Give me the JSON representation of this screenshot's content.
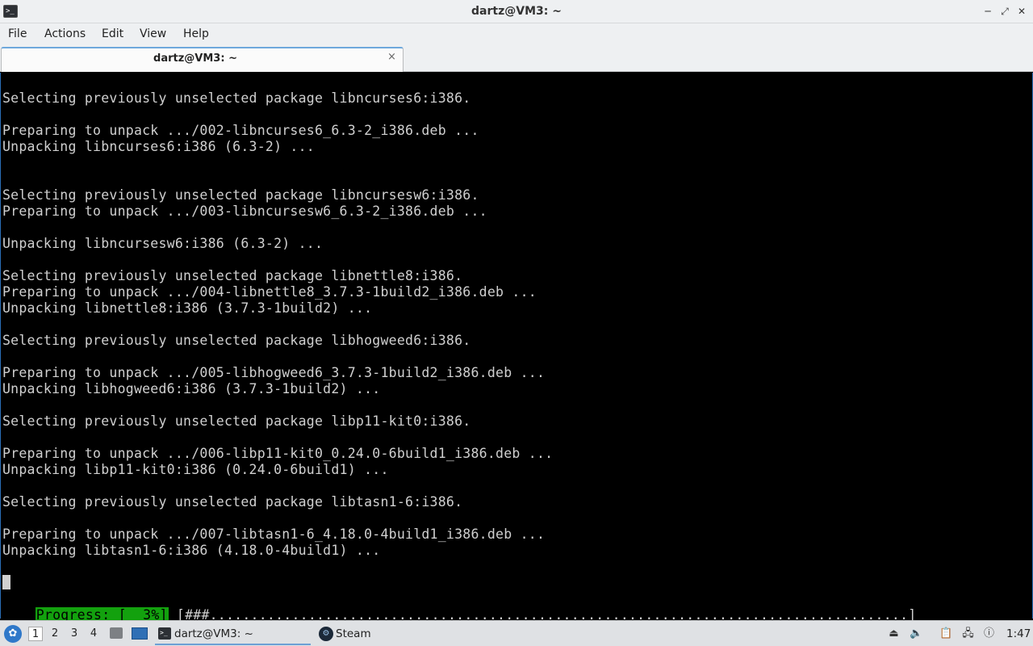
{
  "window": {
    "title": "dartz@VM3: ~"
  },
  "menu": [
    "File",
    "Actions",
    "Edit",
    "View",
    "Help"
  ],
  "tab": {
    "label": "dartz@VM3: ~",
    "close_glyph": "×"
  },
  "terminal": {
    "lines": [
      "Selecting previously unselected package libncurses6:i386.",
      "Preparing to unpack .../002-libncurses6_6.3-2_i386.deb ...",
      "Unpacking libncurses6:i386 (6.3-2) ...",
      "Selecting previously unselected package libncursesw6:i386.",
      "Preparing to unpack .../003-libncursesw6_6.3-2_i386.deb ...",
      "Unpacking libncursesw6:i386 (6.3-2) ...",
      "Selecting previously unselected package libnettle8:i386.",
      "Preparing to unpack .../004-libnettle8_3.7.3-1build2_i386.deb ...",
      "Unpacking libnettle8:i386 (3.7.3-1build2) ...",
      "Selecting previously unselected package libhogweed6:i386.",
      "Preparing to unpack .../005-libhogweed6_3.7.3-1build2_i386.deb ...",
      "Unpacking libhogweed6:i386 (3.7.3-1build2) ...",
      "Selecting previously unselected package libp11-kit0:i386.",
      "Preparing to unpack .../006-libp11-kit0_0.24.0-6build1_i386.deb ...",
      "Unpacking libp11-kit0:i386 (0.24.0-6build1) ...",
      "Selecting previously unselected package libtasn1-6:i386.",
      "Preparing to unpack .../007-libtasn1-6_4.18.0-4build1_i386.deb ...",
      "Unpacking libtasn1-6:i386 (4.18.0-4build1) ..."
    ],
    "progress_label": "Progress: [  3%]",
    "progress_percent": 3,
    "progress_bar": "[###.....................................................................................]"
  },
  "taskbar": {
    "workspaces": [
      "1",
      "2",
      "3",
      "4"
    ],
    "active_workspace": "1",
    "tasks": [
      {
        "label": "dartz@VM3: ~",
        "icon": "terminal-icon"
      },
      {
        "label": "Steam",
        "icon": "steam-icon"
      }
    ],
    "clock": "1:47"
  }
}
